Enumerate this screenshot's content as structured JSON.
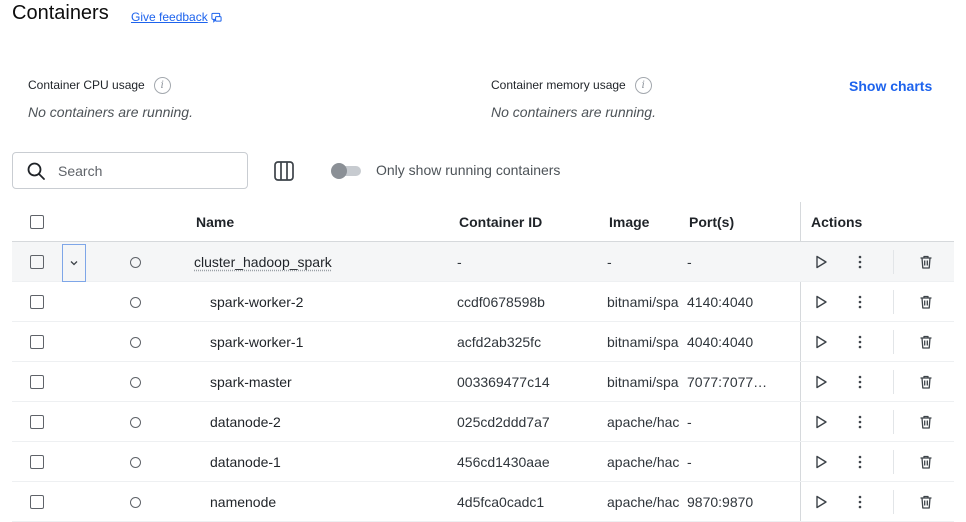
{
  "header": {
    "title": "Containers",
    "feedback_label": "Give feedback"
  },
  "stats": {
    "cpu_label": "Container CPU usage",
    "cpu_empty": "No containers are running.",
    "memory_label": "Container memory usage",
    "memory_empty": "No containers are running.",
    "info_glyph": "i",
    "show_charts_label": "Show charts"
  },
  "toolbar": {
    "search_placeholder": "Search",
    "toggle_label": "Only show running containers",
    "toggle_on": false
  },
  "table": {
    "columns": {
      "name": "Name",
      "container_id": "Container ID",
      "image": "Image",
      "ports": "Port(s)",
      "actions": "Actions"
    },
    "group": {
      "name": "cluster_hadoop_spark",
      "container_id": "-",
      "image": "-",
      "ports": "-"
    },
    "rows": [
      {
        "name": "spark-worker-2",
        "container_id": "ccdf0678598b",
        "image": "bitnami/spa",
        "ports": "4140:4040"
      },
      {
        "name": "spark-worker-1",
        "container_id": "acfd2ab325fc",
        "image": "bitnami/spa",
        "ports": "4040:4040"
      },
      {
        "name": "spark-master",
        "container_id": "003369477c14",
        "image": "bitnami/spa",
        "ports": "7077:7077…"
      },
      {
        "name": "datanode-2",
        "container_id": "025cd2ddd7a7",
        "image": "apache/hac",
        "ports": "-"
      },
      {
        "name": "datanode-1",
        "container_id": "456cd1430aae",
        "image": "apache/hac",
        "ports": "-"
      },
      {
        "name": "namenode",
        "container_id": "4d5fca0cadc1",
        "image": "apache/hac",
        "ports": "9870:9870"
      }
    ]
  },
  "colors": {
    "accent": "#1d63ed",
    "group_row_bg": "#f5f6f7",
    "icon": "#3d4349"
  },
  "icons": {
    "search": "search-icon",
    "columns": "columns-icon",
    "play": "play-icon",
    "more": "kebab-menu-icon",
    "delete": "trash-icon",
    "expand": "chevron-down-icon",
    "feedback": "feedback-icon"
  }
}
